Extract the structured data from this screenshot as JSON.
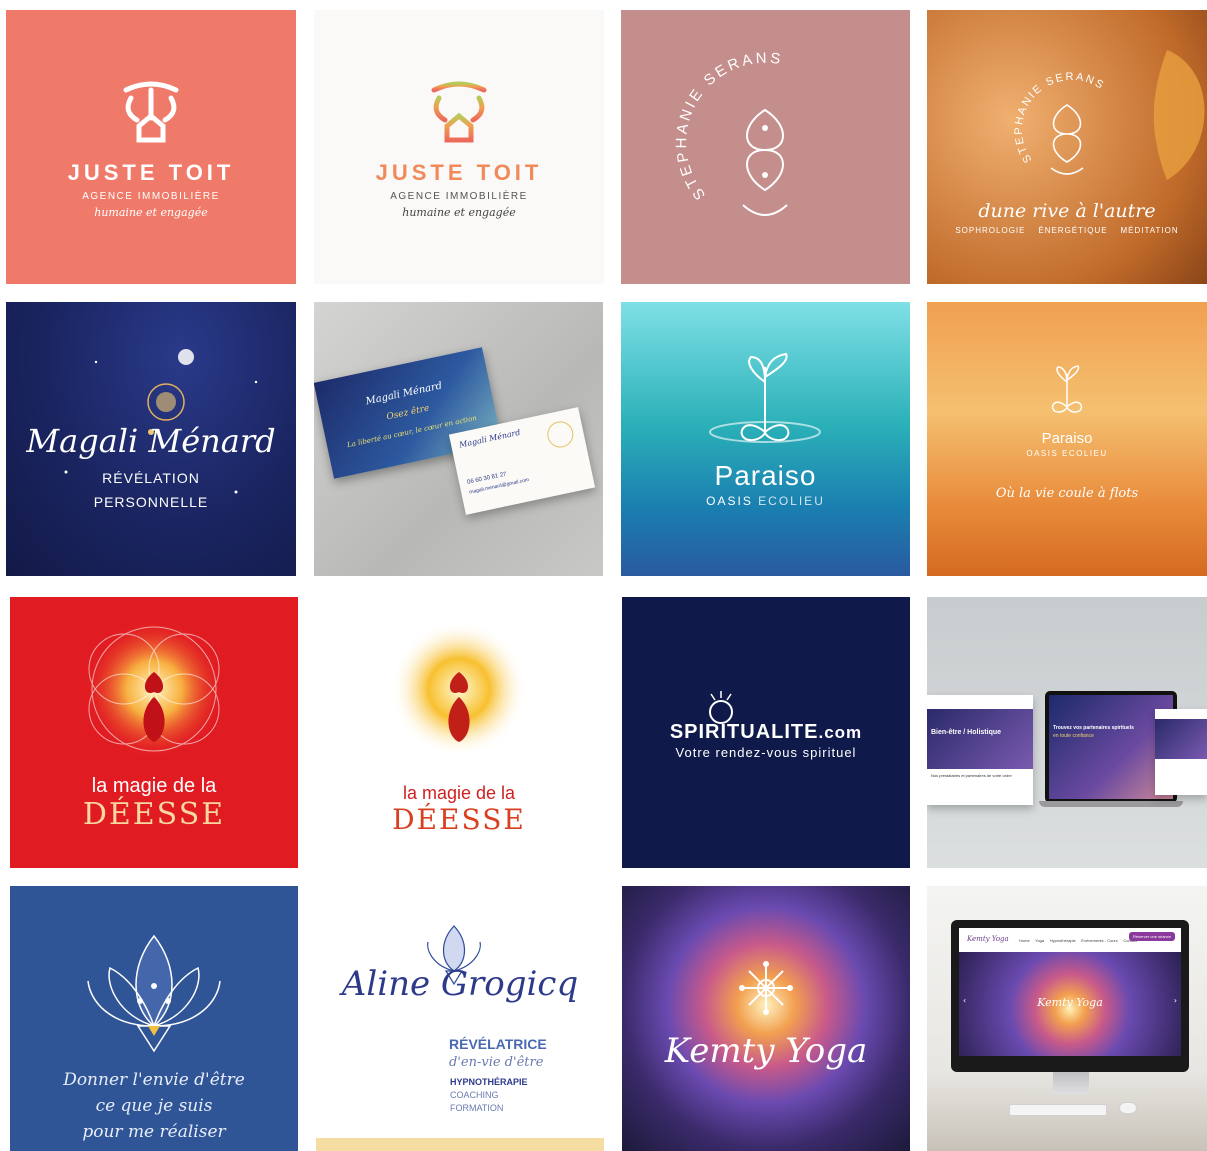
{
  "tiles": {
    "t1": {
      "name": "JUSTE TOIT",
      "line1": "AGENCE IMMOBILIÈRE",
      "line2": "humaine et engagée",
      "bg": "#ef7a6a"
    },
    "t2": {
      "name": "JUSTE TOIT",
      "line1": "AGENCE IMMOBILIÈRE",
      "line2": "humaine et engagée",
      "bg": "#faf9f7"
    },
    "t3": {
      "arc_text": "STEPHANIE SERANS",
      "bg": "#c48e8c"
    },
    "t4": {
      "arc_text": "STEPHANIE SERANS",
      "tagline": "dune rive à l'autre",
      "services": [
        "SOPHROLOGIE",
        "ÉNERGÉTIQUE",
        "MÉDITATION"
      ]
    },
    "t5": {
      "name": "Magali Ménard",
      "line1": "RÉVÉLATION",
      "line2": "PERSONNELLE"
    },
    "t6": {
      "card_front_name": "Magali Ménard",
      "card_front_tag": "Osez être",
      "card_slogan": "La liberté au cœur, le cœur en action",
      "card_back_name": "Magali Ménard",
      "card_back_phone": "06 60 30 81 27",
      "card_back_email": "magali.menard@gmail.com"
    },
    "t7": {
      "name": "Paraiso",
      "sub1": "OASIS",
      "sub2": "ECOLIEU"
    },
    "t8": {
      "name": "Paraiso",
      "sub1": "OASIS",
      "sub2": "ECOLIEU",
      "tagline": "Où la vie coule à flots"
    },
    "t9": {
      "line1": "la magie de la",
      "line2": "DÉESSE",
      "bg": "#e11b22"
    },
    "t10": {
      "line1": "la magie de la",
      "line2": "DÉESSE"
    },
    "t11": {
      "name_main": "SPIRITUALITE",
      "name_tld": ".com",
      "tagline": "Votre rendez-vous spirituel",
      "bg": "#0f1a4a"
    },
    "t12": {
      "left_heading": "Bien-être / Holistique",
      "center_heading": "Trouvez vos partenaires spirituels",
      "center_sub": "en toute confiance",
      "bottom_text": "Nos prestataires et partenaires de votre ordre"
    },
    "t13": {
      "line1": "Donner l'envie d'être",
      "line2": "ce que je suis",
      "line3": "pour me réaliser",
      "bg": "#2f5597"
    },
    "t14": {
      "name": "Aline Grogicq",
      "title": "RÉVÉLATRICE",
      "subtitle": "d'en-vie d'être",
      "services": [
        "HYPNOTHÉRAPIE",
        "COACHING",
        "FORMATION"
      ]
    },
    "t15": {
      "name": "Kemty Yoga"
    },
    "t16": {
      "site_name": "Kemty Yoga",
      "nav": [
        "Home",
        "Yoga",
        "Hypnothérapie",
        "Événements - Cours",
        "Contact"
      ],
      "cta": "Réserver une séance"
    }
  }
}
